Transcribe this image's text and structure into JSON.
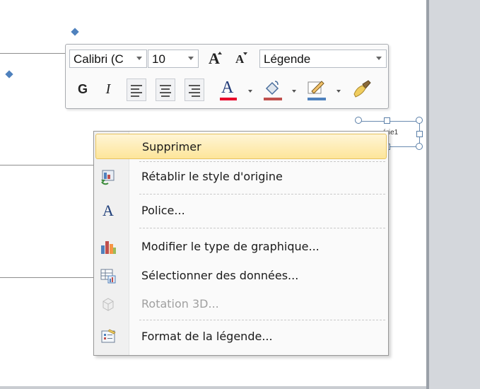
{
  "mini_toolbar": {
    "font_name": "Calibri (C",
    "font_size": "10",
    "grow_font": "A",
    "shrink_font": "A",
    "style_name": "Légende",
    "bold": "G",
    "italic": "I",
    "font_color_glyph": "A",
    "font_color": "#e8002a",
    "fill_color": "#c0504d",
    "line_color": "#4f81bd"
  },
  "chart": {
    "legend_fragment": "érie1"
  },
  "context_menu": {
    "items": [
      {
        "label": "Supprimer",
        "icon": "none",
        "state": "highlighted"
      },
      {
        "label": "Rétablir le style d'origine",
        "icon": "reset-style-icon",
        "state": "enabled"
      },
      {
        "label": "Police...",
        "icon": "font-icon",
        "state": "enabled"
      },
      {
        "label": "Modifier le type de graphique...",
        "icon": "chart-type-icon",
        "state": "enabled"
      },
      {
        "label": "Sélectionner des données...",
        "icon": "select-data-icon",
        "state": "enabled"
      },
      {
        "label": "Rotation 3D...",
        "icon": "rotation-3d-icon",
        "state": "disabled"
      },
      {
        "label": "Format de la légende...",
        "icon": "format-legend-icon",
        "state": "enabled"
      }
    ],
    "font_icon_glyph": "A"
  },
  "colors": {
    "highlight_border": "#e8c45f",
    "accent_blue": "#4f81bd"
  }
}
